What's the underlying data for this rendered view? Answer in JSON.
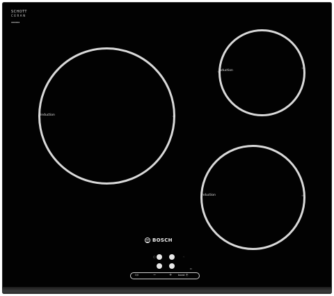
{
  "appliance": {
    "brand_logo": "BOSCH",
    "maker_top": "SCHOTT",
    "maker_sub": "CERAN",
    "zones": [
      {
        "label": "induction"
      },
      {
        "label": "induction"
      },
      {
        "label": "induction"
      }
    ],
    "controls": {
      "on_label": "O/I",
      "minus_label": "−",
      "plus_label": "+",
      "boost_label": "boost Ⓟ"
    }
  },
  "colors": {
    "glass": "#020202",
    "print": "#e0e0e0"
  }
}
